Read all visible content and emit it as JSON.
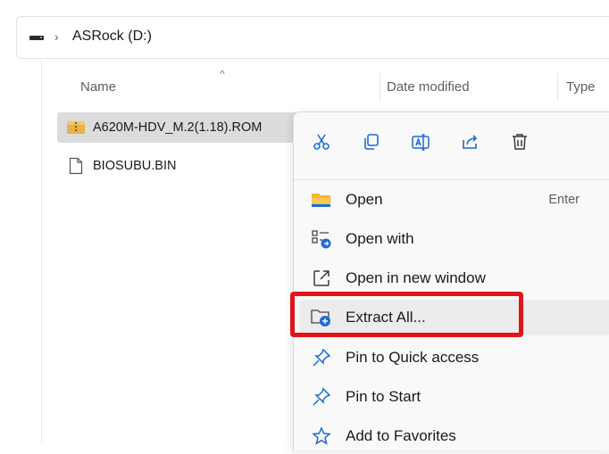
{
  "address_bar": {
    "drive_icon": "drive-icon",
    "chevron": "›",
    "path": "ASRock (D:)"
  },
  "columns": {
    "sort_indicator": "^",
    "name": "Name",
    "date_modified": "Date modified",
    "type": "Type"
  },
  "files": [
    {
      "name": "A620M-HDV_M.2(1.18).ROM",
      "icon": "zip-archive-icon",
      "selected": true
    },
    {
      "name": "BIOSUBU.BIN",
      "icon": "document-icon",
      "selected": false
    }
  ],
  "context_menu": {
    "quick_actions": [
      {
        "name": "cut-icon",
        "label": "Cut"
      },
      {
        "name": "copy-icon",
        "label": "Copy"
      },
      {
        "name": "rename-icon",
        "label": "Rename"
      },
      {
        "name": "share-icon",
        "label": "Share"
      },
      {
        "name": "delete-icon",
        "label": "Delete"
      }
    ],
    "items": [
      {
        "label": "Open",
        "shortcut": "Enter",
        "icon": "folder-open-icon"
      },
      {
        "label": "Open with",
        "shortcut": "",
        "icon": "open-with-icon"
      },
      {
        "label": "Open in new window",
        "shortcut": "",
        "icon": "new-window-icon"
      },
      {
        "label": "Extract All...",
        "shortcut": "",
        "icon": "extract-icon"
      },
      {
        "label": "Pin to Quick access",
        "shortcut": "",
        "icon": "pin-icon"
      },
      {
        "label": "Pin to Start",
        "shortcut": "",
        "icon": "pin-icon"
      },
      {
        "label": "Add to Favorites",
        "shortcut": "",
        "icon": "star-icon"
      }
    ]
  },
  "colors": {
    "highlight": "#e0141a",
    "accent_blue": "#1e6bd6",
    "folder_yellow": "#f2b632"
  }
}
